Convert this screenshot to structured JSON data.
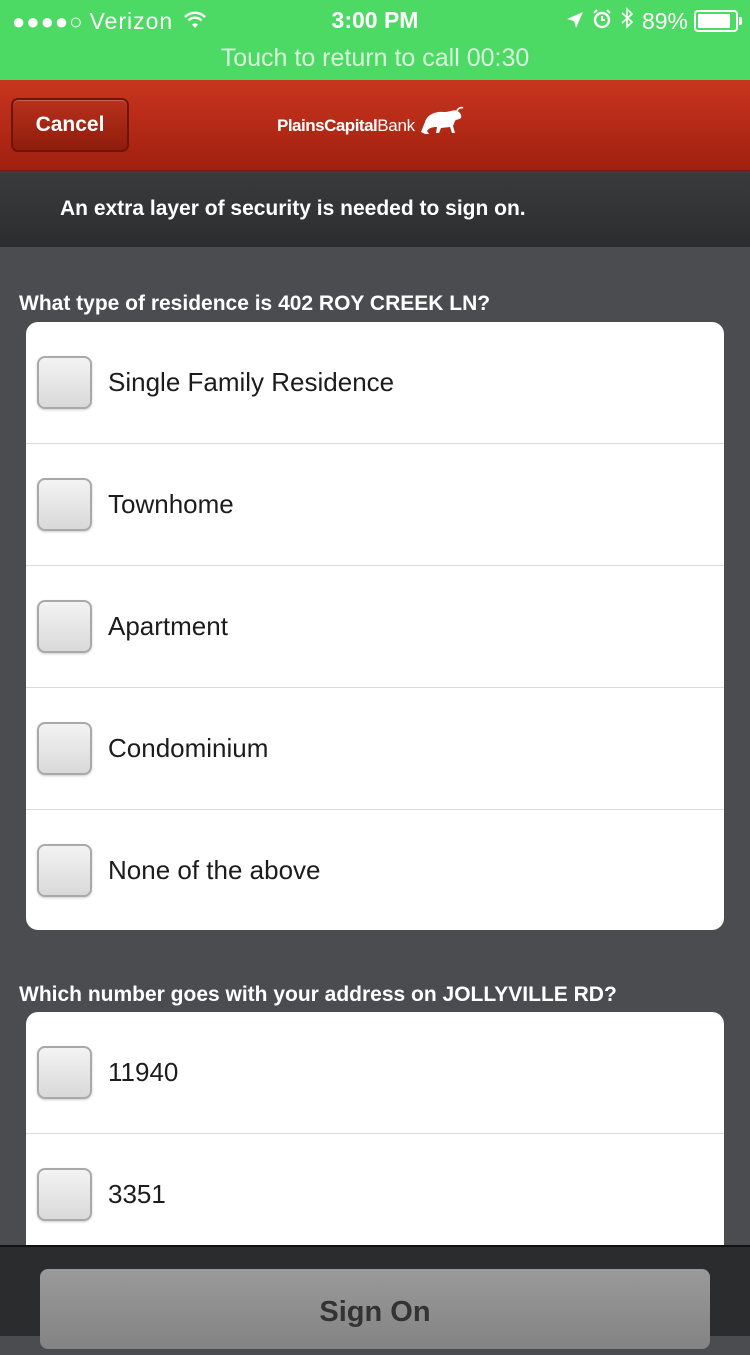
{
  "status_bar": {
    "signal": "●●●●○",
    "carrier": "Verizon",
    "time": "3:00 PM",
    "battery_percent": "89%",
    "battery_level": 0.89,
    "call_banner": "Touch to return to call 00:30",
    "icons": [
      "wifi-icon",
      "location-arrow-icon",
      "alarm-icon",
      "bluetooth-icon",
      "battery-icon"
    ]
  },
  "header": {
    "cancel_label": "Cancel",
    "logo_bold": "PlainsCapital",
    "logo_light": "Bank"
  },
  "info": {
    "message": "An extra layer of security is needed to sign on."
  },
  "questions": [
    {
      "text": "What type of residence is 402 ROY CREEK LN?",
      "options": [
        "Single Family Residence",
        "Townhome",
        "Apartment",
        "Condominium",
        "None of the above"
      ]
    },
    {
      "text": "Which number goes with your address on JOLLYVILLE RD?",
      "options": [
        "11940",
        "3351"
      ]
    }
  ],
  "footer": {
    "sign_on_label": "Sign On"
  },
  "colors": {
    "status_green": "#4cd964",
    "header_red": "#b22a16",
    "background": "#4b4c4f"
  }
}
